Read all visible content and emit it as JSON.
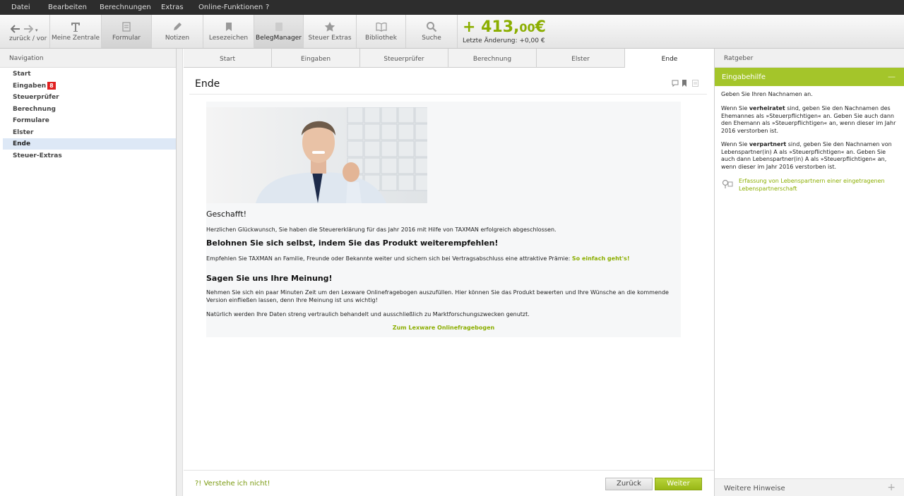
{
  "menu": {
    "items": [
      "Datei",
      "Bearbeiten",
      "Berechnungen",
      "Extras",
      "Online-Funktionen",
      "?"
    ]
  },
  "toolbar": {
    "nav_label": "zurück / vor",
    "buttons": [
      "Meine Zentrale",
      "Formular",
      "Notizen",
      "Lesezeichen",
      "BelegManager",
      "Steuer Extras",
      "Bibliothek",
      "Suche"
    ],
    "amount_main": "+ 413,",
    "amount_cents": "00",
    "amount_currency": "€",
    "last_change": "Letzte Änderung: +0,00 €"
  },
  "navigation": {
    "header": "Navigation",
    "items": [
      "Start",
      "Eingaben",
      "Steuerprüfer",
      "Berechnung",
      "Formulare",
      "Elster",
      "Ende",
      "Steuer-Extras"
    ],
    "badge": "8",
    "selected": "Ende"
  },
  "tabs": {
    "items": [
      "Start",
      "Eingaben",
      "Steuerprüfer",
      "Berechnung",
      "Elster",
      "Ende"
    ],
    "selected": "Ende"
  },
  "page": {
    "title": "Ende",
    "h_done": "Geschafft!",
    "p_done": "Herzlichen Glückwunsch, Sie haben die Steuererklärung für das Jahr 2016 mit Hilfe von TAXMAN erfolgreich abgeschlossen.",
    "h_recommend": "Belohnen Sie sich selbst, indem Sie das Produkt weiterempfehlen!",
    "p_recommend": "Empfehlen Sie TAXMAN an Familie, Freunde oder Bekannte weiter und sichern sich bei Vertragsabschluss eine attraktive Prämie:",
    "link_recommend": "So einfach geht's!",
    "h_opinion": "Sagen Sie uns Ihre Meinung!",
    "p_opinion": "Nehmen Sie sich ein paar Minuten Zeit um den Lexware Onlinefragebogen auszufüllen. Hier können Sie das Produkt bewerten und Ihre Wünsche an die kommende Version einfließen lassen, denn Ihre Meinung ist uns wichtig!",
    "p_privacy": "Natürlich werden Ihre Daten streng vertraulich behandelt und ausschließlich zu Marktforschungszwecken genutzt.",
    "link_survey": "Zum Lexware Onlinefragebogen"
  },
  "bottom": {
    "not_understood": "?! Verstehe ich nicht!",
    "back": "Zurück",
    "next": "Weiter"
  },
  "advisor": {
    "header": "Ratgeber",
    "section": "Eingabehilfe",
    "p1": "Geben Sie Ihren Nachnamen an.",
    "p2_pre": "Wenn Sie ",
    "p2_bold": "verheiratet",
    "p2_post": " sind, geben Sie den Nachnamen des Ehemannes als »Steuerpflichtigen« an. Geben Sie auch dann den Ehemann als »Steuerpflichtigen« an, wenn dieser im Jahr 2016 verstorben ist.",
    "p3_pre": "Wenn Sie ",
    "p3_bold": "verpartnert",
    "p3_post": " sind, geben Sie den Nachnamen von Lebenspartner(in) A als »Steuerpflichtigen« an. Geben Sie auch dann Lebenspartner(in) A als »Steuerpflichtigen« an, wenn dieser im Jahr 2016 verstorben ist.",
    "link": "Erfassung von Lebenspartnern einer eingetragenen Lebenspartnerschaft",
    "further": "Weitere Hinweise"
  },
  "colors": {
    "accent": "#8bae00",
    "panel_green": "#a4c52a",
    "badge": "#e02020",
    "menubar": "#2d2d2d"
  }
}
